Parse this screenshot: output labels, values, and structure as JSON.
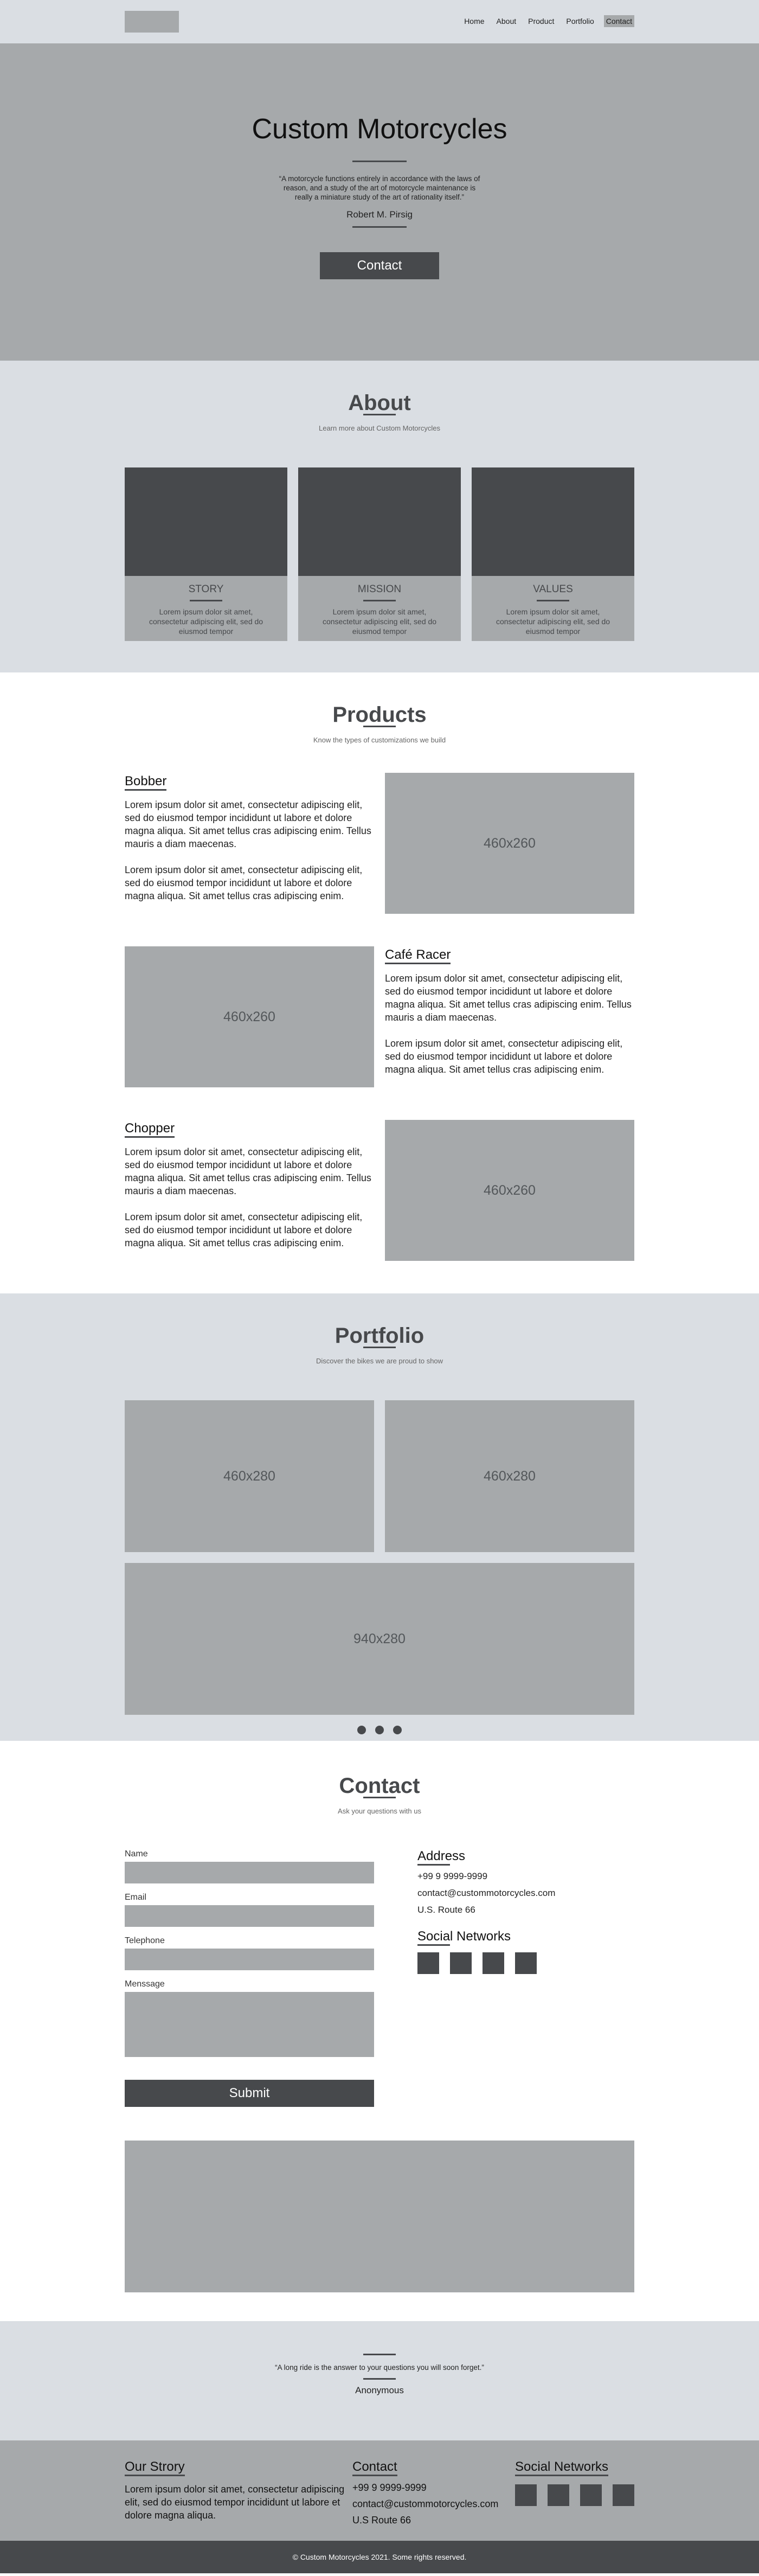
{
  "nav": {
    "items": [
      "Home",
      "About",
      "Product",
      "Portfolio",
      "Contact"
    ]
  },
  "hero": {
    "title": "Custom Motorcycles",
    "quote": "“A motorcycle functions entirely in accordance with the laws of reason, and a study of the art of motorcycle maintenance is really a miniature study of the art of rationality itself.”",
    "author": "Robert M. Pirsig",
    "button": "Contact"
  },
  "about": {
    "title": "About",
    "subtitle": "Learn more about Custom Motorcycles",
    "cards": [
      {
        "title": "STORY",
        "text": "Lorem ipsum dolor sit amet, consectetur adipiscing elit, sed do eiusmod tempor"
      },
      {
        "title": "MISSION",
        "text": "Lorem ipsum dolor sit amet, consectetur adipiscing elit, sed do eiusmod tempor"
      },
      {
        "title": "VALUES",
        "text": "Lorem ipsum dolor sit amet, consectetur adipiscing elit, sed do eiusmod tempor"
      }
    ]
  },
  "products": {
    "title": "Products",
    "subtitle": "Know the types of customizations we build",
    "items": [
      {
        "name": "Bobber",
        "p1": "Lorem ipsum dolor sit amet, consectetur adipiscing elit, sed do eiusmod tempor incididunt ut labore et dolore magna aliqua. Sit amet tellus cras adipiscing enim. Tellus mauris a diam maecenas.",
        "p2": "Lorem ipsum dolor sit amet, consectetur adipiscing elit, sed do eiusmod tempor incididunt ut labore et dolore magna aliqua. Sit amet tellus cras adipiscing enim.",
        "image": "460x260"
      },
      {
        "name": "Café Racer",
        "p1": "Lorem ipsum dolor sit amet, consectetur adipiscing elit, sed do eiusmod tempor incididunt ut labore et dolore magna aliqua. Sit amet tellus cras adipiscing enim. Tellus mauris a diam maecenas.",
        "p2": "Lorem ipsum dolor sit amet, consectetur adipiscing elit, sed do eiusmod tempor incididunt ut labore et dolore magna aliqua. Sit amet tellus cras adipiscing enim.",
        "image": "460x260"
      },
      {
        "name": "Chopper",
        "p1": "Lorem ipsum dolor sit amet, consectetur adipiscing elit, sed do eiusmod tempor incididunt ut labore et dolore magna aliqua. Sit amet tellus cras adipiscing enim. Tellus mauris a diam maecenas.",
        "p2": "Lorem ipsum dolor sit amet, consectetur adipiscing elit, sed do eiusmod tempor incididunt ut labore et dolore magna aliqua. Sit amet tellus cras adipiscing enim.",
        "image": "460x260"
      }
    ]
  },
  "portfolio": {
    "title": "Portfolio",
    "subtitle": "Discover the bikes we are proud to show",
    "images": [
      "460x280",
      "460x280",
      "940x280"
    ],
    "dot_count": 3
  },
  "contact": {
    "title": "Contact",
    "subtitle": "Ask your questions with us",
    "form": {
      "name_label": "Name",
      "email_label": "Email",
      "telephone_label": "Telephone",
      "message_label": "Menssage",
      "submit": "Submit"
    },
    "address": {
      "title": "Address",
      "phone": "+99 9 9999-9999",
      "email": "contact@custommotorcycles.com",
      "street": "U.S. Route 66"
    },
    "social_title": "Social Networks"
  },
  "quote": {
    "text": "“A long ride is the answer to your questions you will soon forget.”",
    "author": "Anonymous"
  },
  "footer": {
    "story_title": "Our Strory",
    "story_text": "Lorem ipsum dolor sit amet, consectetur adipiscing elit, sed do eiusmod tempor incididunt ut labore et dolore magna aliqua.",
    "contact_title": "Contact",
    "phone": "+99 9 9999-9999",
    "email": "contact@custommotorcycles.com",
    "street": "U.S Route 66",
    "social_title": "Social Networks"
  },
  "copyright": "© Custom Motorcycles 2021. Some rights reserved.",
  "colors": {
    "light_gray": "#dadee3",
    "mid_gray": "#a6a9ab",
    "dark_gray": "#47494c"
  }
}
